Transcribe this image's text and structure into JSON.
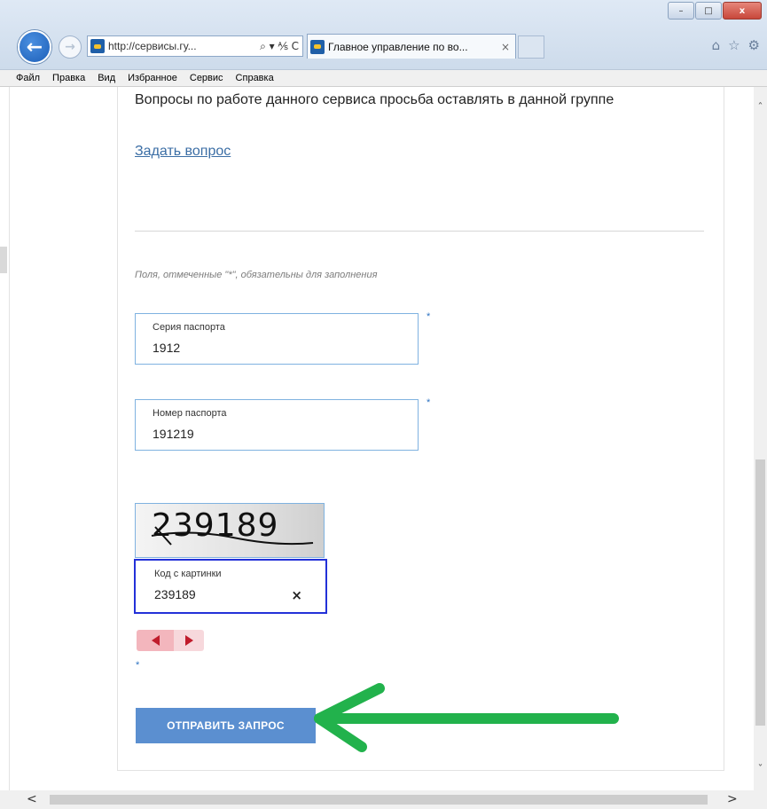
{
  "browser": {
    "address_url": "http://сервисы.гу...",
    "address_tools": "⌕ ▾ ⅍ C",
    "tab_title": "Главное управление по во...",
    "tab_close": "×",
    "window_buttons": {
      "minimize": "–",
      "maximize": "□",
      "close": "x"
    }
  },
  "menu": {
    "items": [
      "Файл",
      "Правка",
      "Вид",
      "Избранное",
      "Сервис",
      "Справка"
    ]
  },
  "page": {
    "notice": "Вопросы по работе данного сервиса просьба оставлять в данной группе",
    "ask_link": "Задать вопрос",
    "required_note": "Поля, отмеченные \"*\", обязательны для заполнения",
    "required_marker": "*",
    "fields": {
      "passport_series": {
        "label": "Серия паспорта",
        "value": "1912"
      },
      "passport_number": {
        "label": "Номер паспорта",
        "value": "191219"
      },
      "captcha_code": {
        "label": "Код с картинки",
        "value": "239189"
      }
    },
    "captcha_image_text": "239189",
    "clear_button": "×",
    "submit_button": "ОТПРАВИТЬ ЗАПРОС"
  },
  "colors": {
    "link": "#3b6ea5",
    "submit_bg": "#5b8fd0",
    "focus_border": "#2331d8",
    "field_border": "#7fb2e0",
    "annotation_arrow": "#22b24c",
    "audio_control": "#c01c2c"
  },
  "icons": [
    "back-arrow-icon",
    "forward-arrow-icon",
    "home-icon",
    "star-icon",
    "gear-icon",
    "clear-icon",
    "play-back-icon",
    "play-forward-icon"
  ]
}
